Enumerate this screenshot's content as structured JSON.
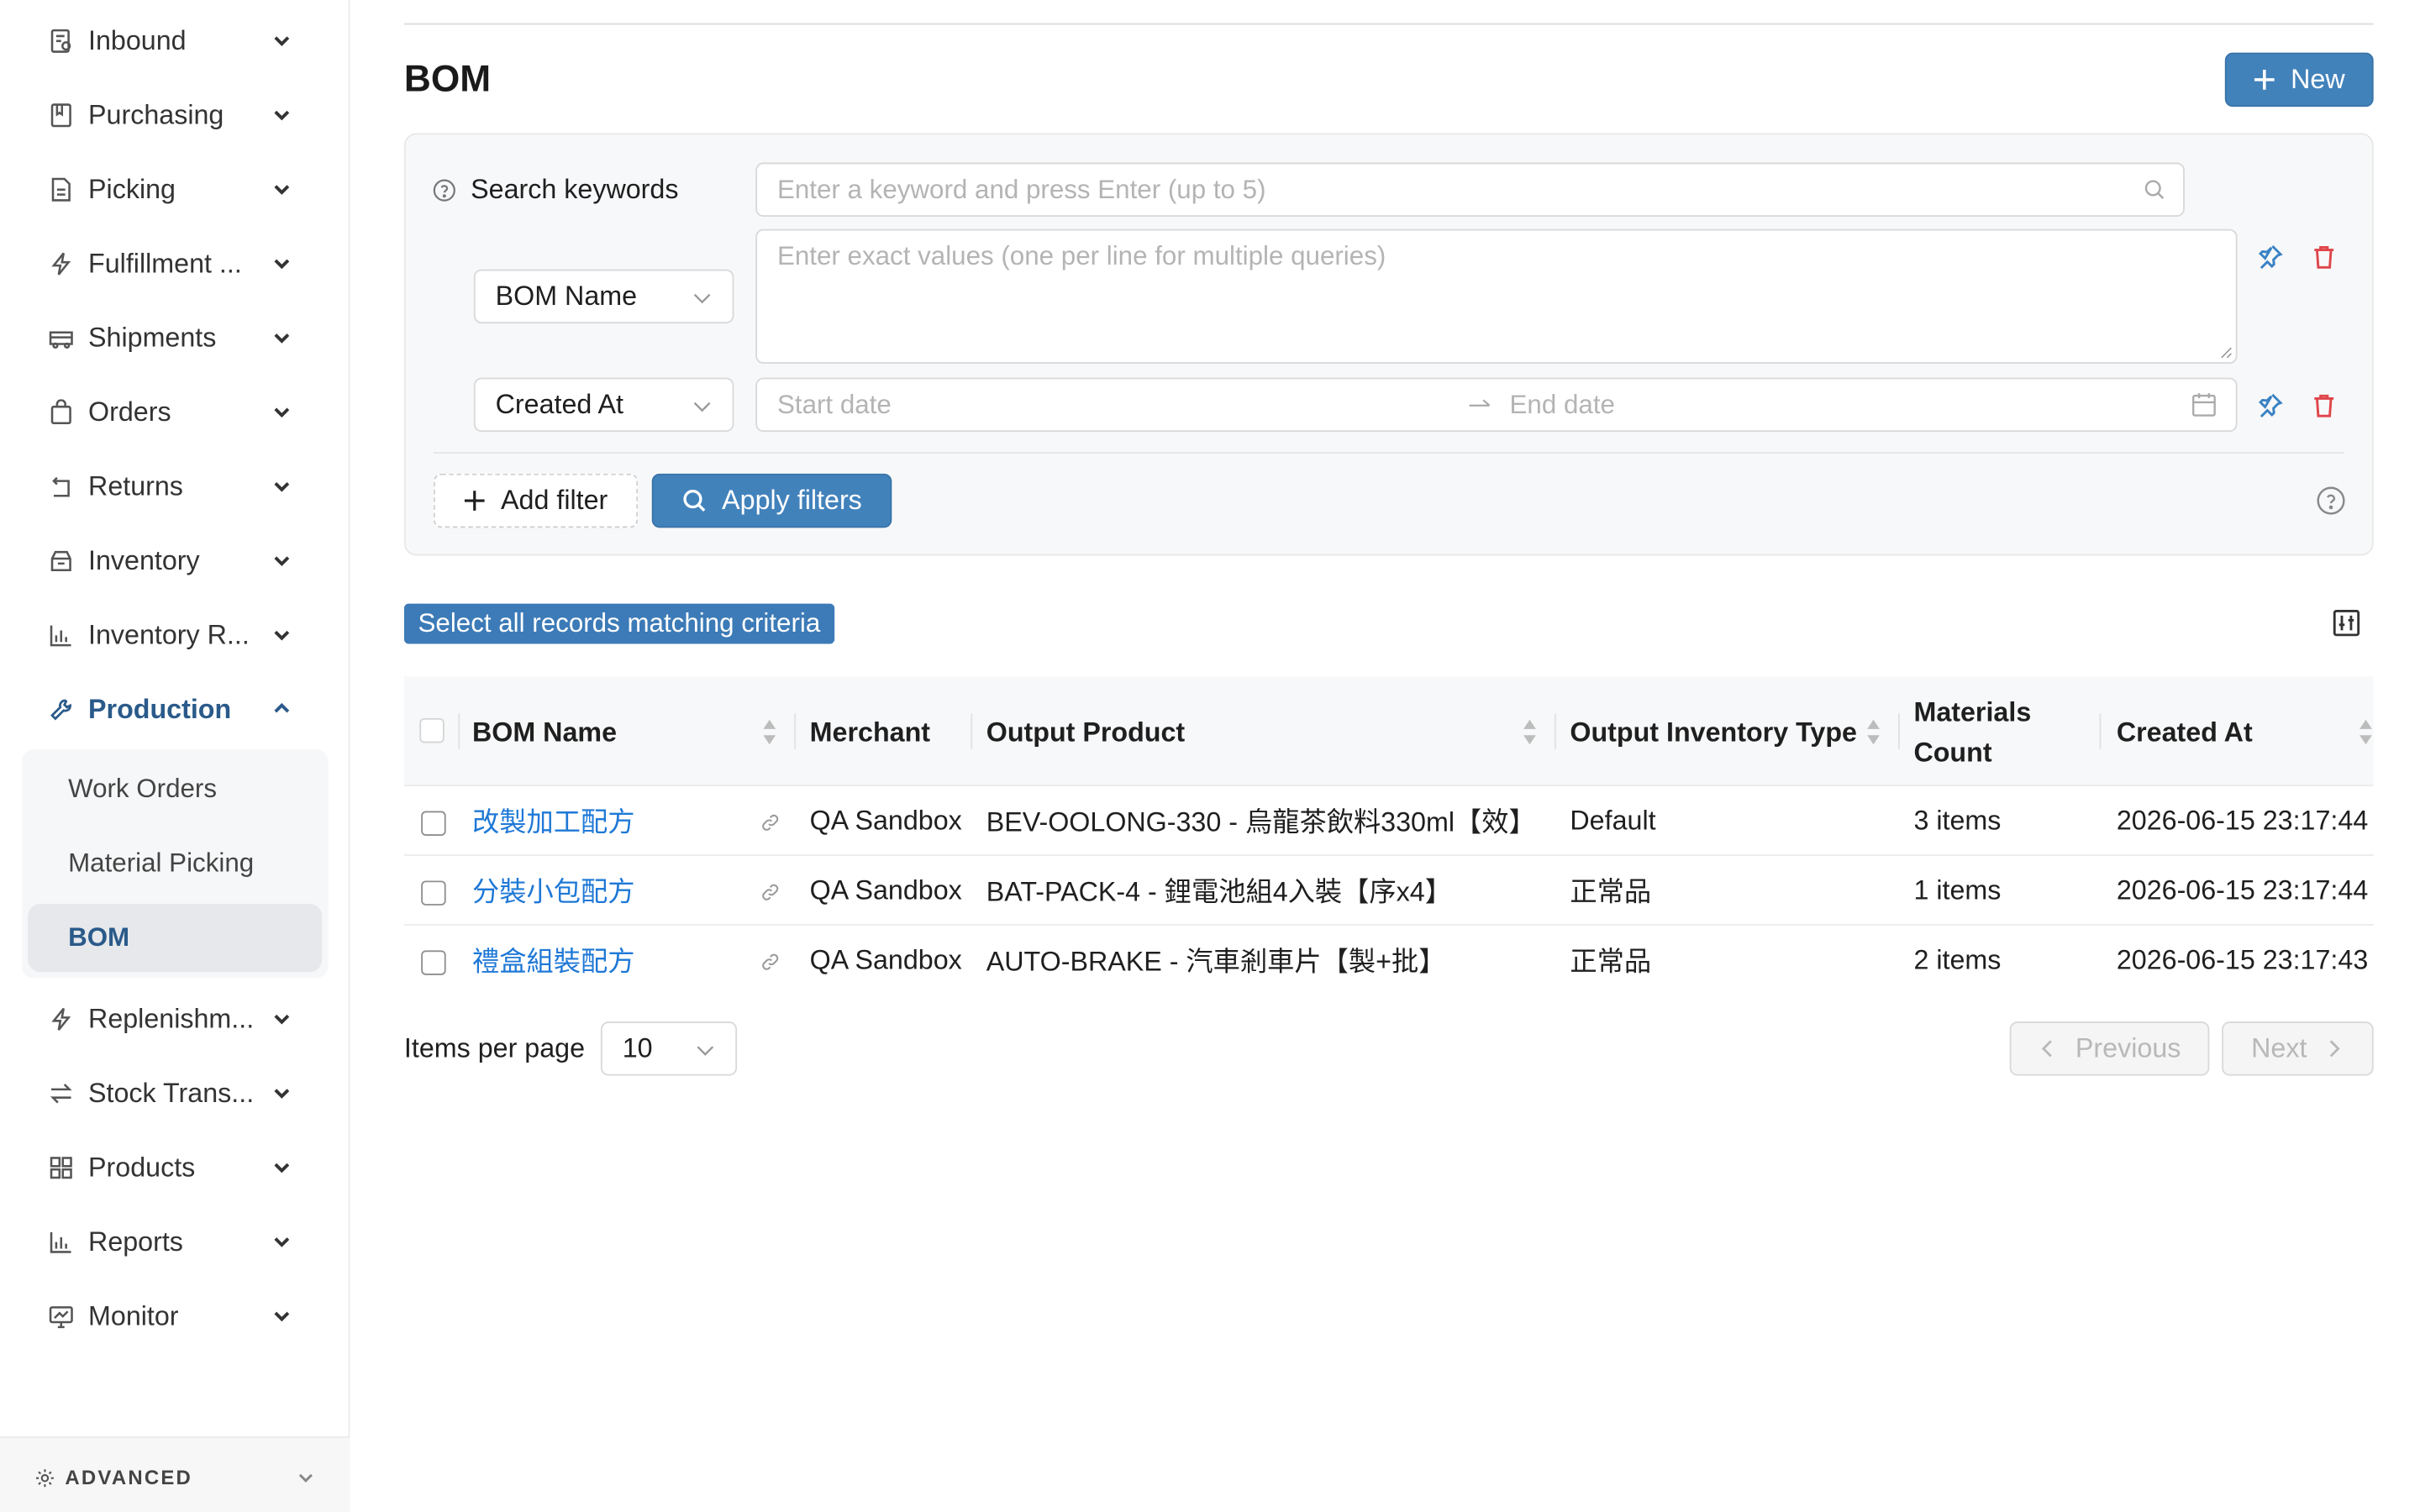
{
  "sidebar": {
    "items": [
      {
        "label": "Inbound",
        "icon": "inbound-icon"
      },
      {
        "label": "Purchasing",
        "icon": "purchasing-icon"
      },
      {
        "label": "Picking",
        "icon": "picking-icon"
      },
      {
        "label": "Fulfillment ...",
        "icon": "lightning-icon"
      },
      {
        "label": "Shipments",
        "icon": "truck-icon"
      },
      {
        "label": "Orders",
        "icon": "shopping-bag-icon"
      },
      {
        "label": "Returns",
        "icon": "return-icon"
      },
      {
        "label": "Inventory",
        "icon": "inventory-box-icon"
      },
      {
        "label": "Inventory R...",
        "icon": "bar-chart-icon"
      },
      {
        "label": "Production",
        "icon": "tool-icon",
        "expanded": true
      },
      {
        "label": "Replenishm...",
        "icon": "lightning-icon"
      },
      {
        "label": "Stock Trans...",
        "icon": "transfer-icon"
      },
      {
        "label": "Products",
        "icon": "grid-icon"
      },
      {
        "label": "Reports",
        "icon": "bar-chart-icon"
      },
      {
        "label": "Monitor",
        "icon": "monitor-icon"
      }
    ],
    "production_submenu": [
      {
        "label": "Work Orders"
      },
      {
        "label": "Material Picking"
      },
      {
        "label": "BOM",
        "active": true
      }
    ],
    "advanced_label": "ADVANCED"
  },
  "header": {
    "title": "BOM",
    "new_button": "New"
  },
  "filters": {
    "keyword_label": "Search keywords",
    "keyword_placeholder": "Enter a keyword and press Enter (up to 5)",
    "field1_select": "BOM Name",
    "field1_placeholder": "Enter exact values (one per line for multiple queries)",
    "field2_select": "Created At",
    "start_placeholder": "Start date",
    "end_placeholder": "End date",
    "add_filter": "Add filter",
    "apply_filters": "Apply filters"
  },
  "select_all_label": "Select all records matching criteria",
  "table": {
    "headers": {
      "bom_name": "BOM Name",
      "merchant": "Merchant",
      "output_product": "Output Product",
      "output_inventory_type": "Output Inventory Type",
      "materials_count_1": "Materials",
      "materials_count_2": "Count",
      "created_at": "Created At"
    },
    "rows": [
      {
        "bom_name": "改製加工配方",
        "merchant": "QA Sandbox",
        "output_product": "BEV-OOLONG-330 - 烏龍茶飲料330ml【效】",
        "inventory_type": "Default",
        "materials_count": "3 items",
        "created_at": "2026-06-15 23:17:44"
      },
      {
        "bom_name": "分裝小包配方",
        "merchant": "QA Sandbox",
        "output_product": "BAT-PACK-4 - 鋰電池組4入裝【序x4】",
        "inventory_type": "正常品",
        "materials_count": "1 items",
        "created_at": "2026-06-15 23:17:44"
      },
      {
        "bom_name": "禮盒組裝配方",
        "merchant": "QA Sandbox",
        "output_product": "AUTO-BRAKE - 汽車剎車片【製+批】",
        "inventory_type": "正常品",
        "materials_count": "2 items",
        "created_at": "2026-06-15 23:17:43"
      }
    ]
  },
  "pagination": {
    "items_per_page_label": "Items per page",
    "page_size": "10",
    "previous": "Previous",
    "next": "Next"
  },
  "colors": {
    "primary": "#4282bb",
    "link": "#1e78d6",
    "active_nav": "#2a5a8a",
    "danger": "#e0454a"
  }
}
